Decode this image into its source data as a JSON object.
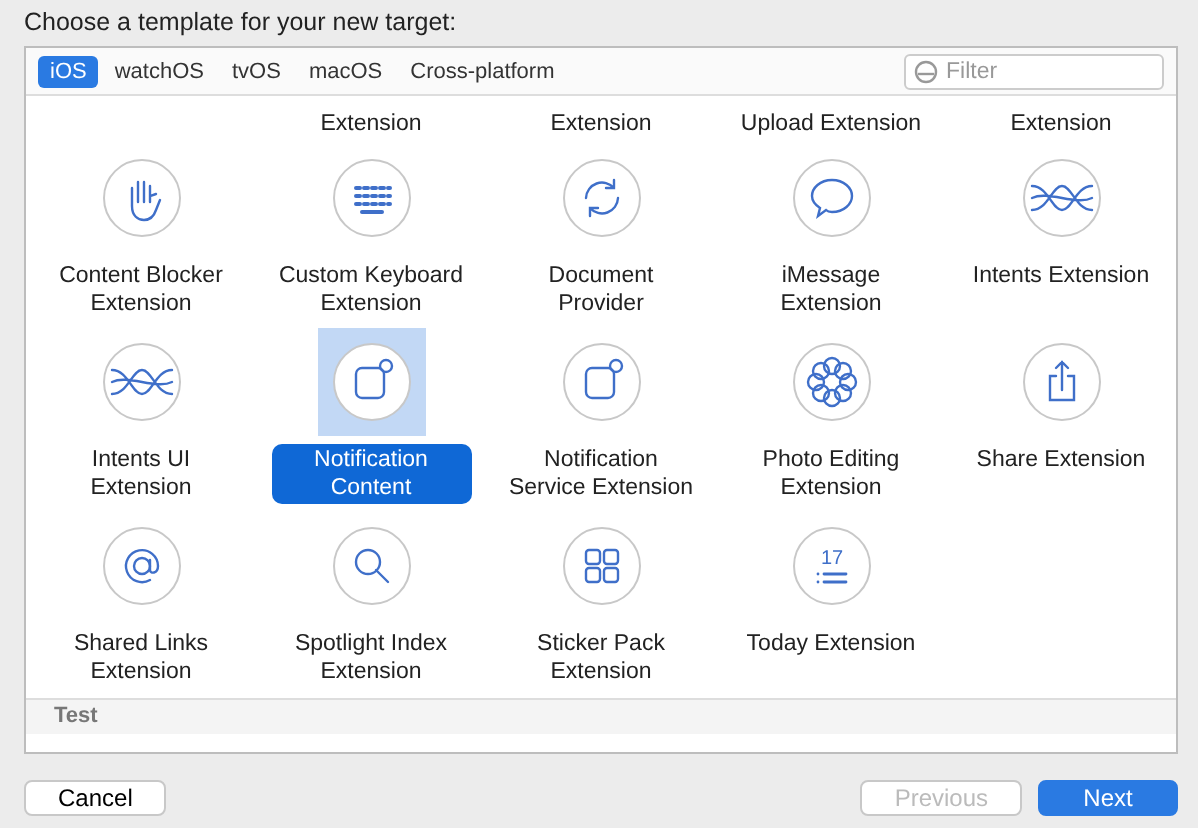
{
  "heading": "Choose a template for your new target:",
  "tabs": [
    {
      "label": "iOS",
      "selected": true
    },
    {
      "label": "watchOS",
      "selected": false
    },
    {
      "label": "tvOS",
      "selected": false
    },
    {
      "label": "macOS",
      "selected": false
    },
    {
      "label": "Cross-platform",
      "selected": false
    }
  ],
  "filter": {
    "placeholder": "Filter"
  },
  "cut_row": [
    {
      "label": "Extension"
    },
    {
      "label": "Extension"
    },
    {
      "label": "Upload Extension"
    },
    {
      "label": "Extension"
    }
  ],
  "templates": [
    {
      "kind": "hand",
      "label": [
        "Content Blocker",
        "Extension"
      ],
      "selected": false
    },
    {
      "kind": "keyboard",
      "label": [
        "Custom Keyboard",
        "Extension"
      ],
      "selected": false
    },
    {
      "kind": "sync",
      "label": [
        "Document",
        "Provider"
      ],
      "selected": false
    },
    {
      "kind": "bubble",
      "label": [
        "iMessage",
        "Extension"
      ],
      "selected": false
    },
    {
      "kind": "waves",
      "label": [
        "Intents Extension"
      ],
      "selected": false
    },
    {
      "kind": "waves",
      "label": [
        "Intents UI",
        "Extension"
      ],
      "selected": false
    },
    {
      "kind": "notification",
      "label": [
        "Notification",
        "Content"
      ],
      "selected": true
    },
    {
      "kind": "notification",
      "label": [
        "Notification",
        "Service Extension"
      ],
      "selected": false
    },
    {
      "kind": "flower",
      "label": [
        "Photo Editing",
        "Extension"
      ],
      "selected": false
    },
    {
      "kind": "share",
      "label": [
        "Share Extension"
      ],
      "selected": false
    },
    {
      "kind": "at",
      "label": [
        "Shared Links",
        "Extension"
      ],
      "selected": false
    },
    {
      "kind": "search",
      "label": [
        "Spotlight Index",
        "Extension"
      ],
      "selected": false
    },
    {
      "kind": "grid",
      "label": [
        "Sticker Pack",
        "Extension"
      ],
      "selected": false
    },
    {
      "kind": "calendar",
      "label": [
        "Today Extension"
      ],
      "selected": false,
      "icon_text": "17"
    }
  ],
  "section": "Test",
  "buttons": [
    {
      "label": "Cancel",
      "kind": "plain"
    },
    {
      "label": "Previous",
      "kind": "disabled"
    },
    {
      "label": "Next",
      "kind": "default"
    }
  ]
}
